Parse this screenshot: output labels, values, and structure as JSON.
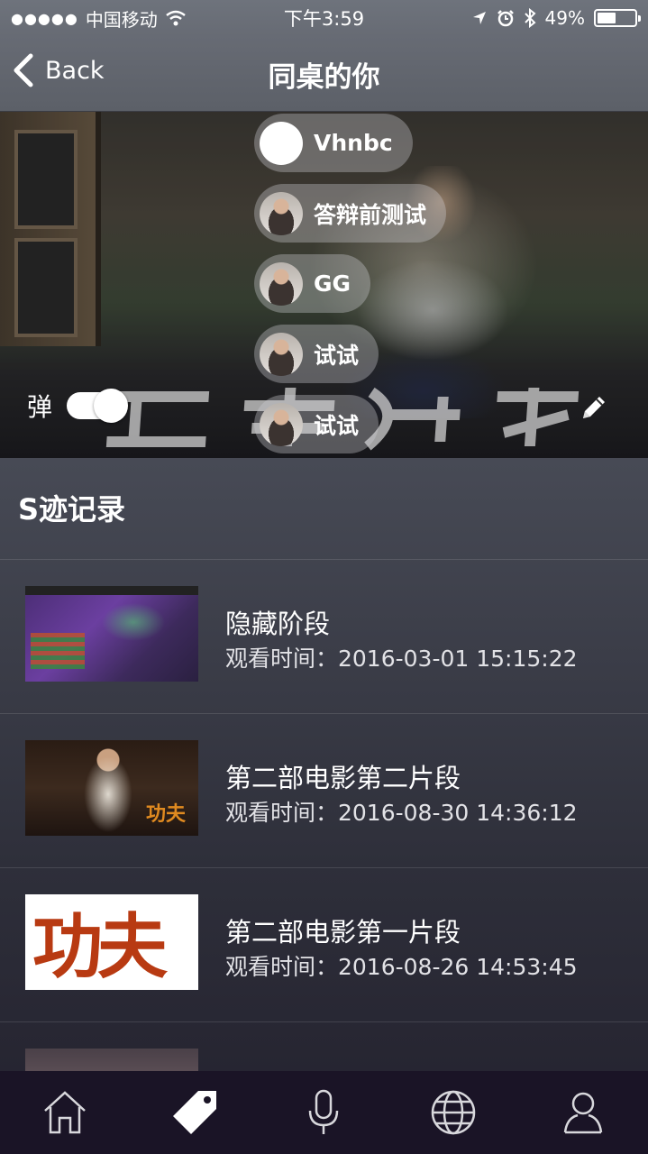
{
  "status_bar": {
    "signal_dots": "●●●●●",
    "carrier": "中国移动",
    "time": "下午3:59",
    "battery_percent": "49%",
    "battery_level": 0.49
  },
  "nav": {
    "back_label": "Back",
    "title": "同桌的你"
  },
  "danmaku": [
    {
      "user": "Vhnbc",
      "avatar": "blank"
    },
    {
      "user": "答辩前测试",
      "avatar": "photo"
    },
    {
      "user": "GG",
      "avatar": "photo"
    },
    {
      "user": "试试",
      "avatar": "photo"
    },
    {
      "user": "试试",
      "avatar": "photo"
    }
  ],
  "danmaku_toggle": {
    "label": "弹",
    "on": true
  },
  "section": {
    "title": "S迹记录"
  },
  "history": [
    {
      "title": "隐藏阶段",
      "time": "观看时间：2016-03-01 15:15:22",
      "thumb": "game"
    },
    {
      "title": "第二部电影第二片段",
      "time": "观看时间：2016-08-30 14:36:12",
      "thumb": "kungfu"
    },
    {
      "title": "第二部电影第一片段",
      "time": "观看时间：2016-08-26 14:53:45",
      "thumb": "poster2"
    },
    {
      "title": "",
      "time": "",
      "thumb": "crowd"
    }
  ],
  "tabs": [
    {
      "icon": "home-icon",
      "active": false
    },
    {
      "icon": "tag-icon",
      "active": true
    },
    {
      "icon": "microphone-icon",
      "active": false
    },
    {
      "icon": "globe-icon",
      "active": false
    },
    {
      "icon": "user-icon",
      "active": false
    }
  ]
}
